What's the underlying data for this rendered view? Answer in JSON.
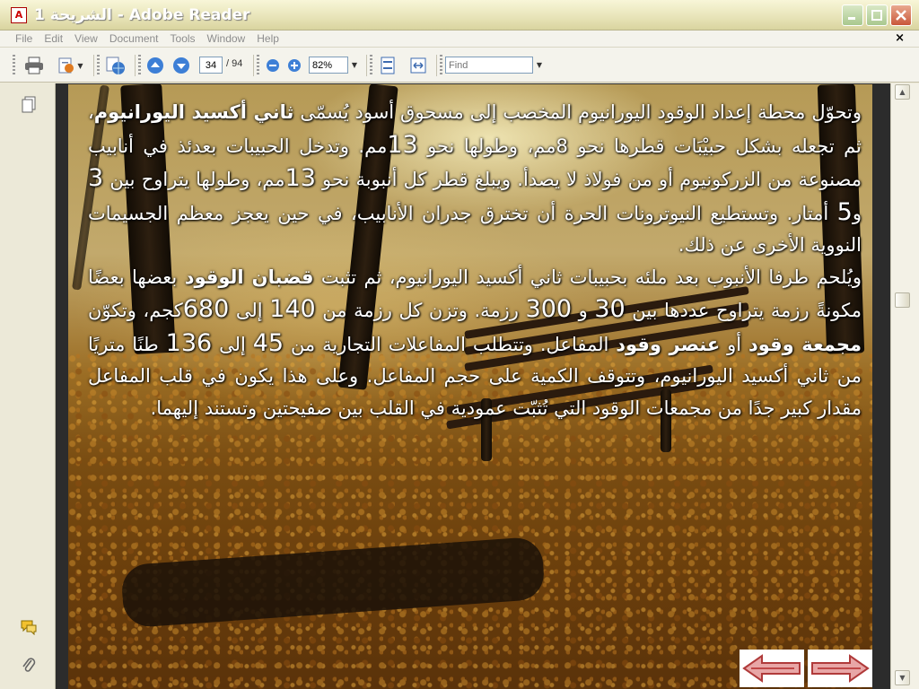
{
  "window": {
    "title": "الشريحة 1 - Adobe Reader",
    "icon": "pdf-icon",
    "buttons": [
      "minimize-icon",
      "maximize-icon",
      "close-icon"
    ]
  },
  "menu": {
    "items": [
      "File",
      "Edit",
      "View",
      "Document",
      "Tools",
      "Window",
      "Help"
    ],
    "close_glyph": "×"
  },
  "toolbar": {
    "current_page": "34",
    "page_separator": "/ 94",
    "zoom": "82%",
    "find_placeholder": "Find"
  },
  "slide": {
    "paragraph1": [
      {
        "t": "وتحوّل محطة إعداد الوقود اليورانيوم المخصب إلى مسحوق أسود يُسمّى "
      },
      {
        "t": "ثاني أكسيد اليورانيوم",
        "b": true
      },
      {
        "t": "، ثم تجعله بشكل حبيْبَات قطرها نحو 8مم، وطولها نحو "
      },
      {
        "t": "13",
        "n": true
      },
      {
        "t": "مم. وتدخل الحبيبات بعدئذ في أنابيب مصنوعة من الزركونيوم أو من فولاذ لا يصدأ. ويبلغ قطر كل أنبوبة نحو "
      },
      {
        "t": "13",
        "n": true
      },
      {
        "t": "مم، وطولها يتراوح بين "
      },
      {
        "t": "3",
        "n": true
      },
      {
        "t": " و"
      },
      {
        "t": "5",
        "n": true
      },
      {
        "t": " أمتار. وتستطيع النيوترونات الحرة أن تخترق جدران الأنابيب، في حين يعجز معظم الجسيمات النووية الأخرى عن ذلك."
      }
    ],
    "paragraph2": [
      {
        "t": "ويُلحم طرفا الأنبوب بعد ملئه بحبيبات ثاني أكسيد اليورانيوم، ثم تثبت "
      },
      {
        "t": "قضبان الوقود",
        "b": true
      },
      {
        "t": " بعضها بعضًا مكونةً رزمة يتراوح عددها بين "
      },
      {
        "t": "30",
        "n": true
      },
      {
        "t": " و "
      },
      {
        "t": "300",
        "n": true
      },
      {
        "t": " رزمة. وتزن كل رزمة من "
      },
      {
        "t": "140",
        "n": true
      },
      {
        "t": " إلى "
      },
      {
        "t": "680",
        "n": true
      },
      {
        "t": "كجم، وتكوّن "
      },
      {
        "t": "مجمعة وقود",
        "b": true
      },
      {
        "t": " أو "
      },
      {
        "t": "عنصر وقود",
        "b": true
      },
      {
        "t": " المفاعل. وتتطلب المفاعلات التجارية من "
      },
      {
        "t": "45",
        "n": true
      },
      {
        "t": " إلى "
      },
      {
        "t": "136",
        "n": true
      },
      {
        "t": " طنًا متريًا من ثاني أكسيد اليورانيوم، وتتوقف الكمية على حجم المفاعل. وعلى هذا يكون في قلب المفاعل مقدار كبير جدًا من مجمعات الوقود التي تُثبّت عمودية في القلب بين صفيحتين وتستند إليهما."
      }
    ]
  },
  "colors": {
    "title_bar": "#e7e3b7",
    "chrome": "#f4f3ec",
    "doc_background": "#2c2c2c",
    "slide_text": "#ffffff",
    "nav_arrow": "#c0392b"
  }
}
